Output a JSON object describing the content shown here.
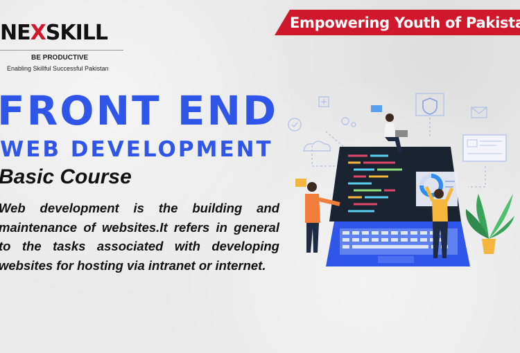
{
  "banner": {
    "text": "Empowering Youth of Pakistan",
    "color": "#d0182c"
  },
  "logo": {
    "word_left": "NE",
    "word_x": "X",
    "word_right": "SKILL",
    "tagline": "BE PRODUCTIVE",
    "subtitle": "Enabling Skillful Successful Pakistan"
  },
  "course": {
    "title_line1": "FRONT END",
    "title_line2": "WEB DEVELOPMENT",
    "subtitle": "Basic Course",
    "description": "Web development is the building and maintenance of websites.It refers in general to the tasks associated with developing websites for hosting via intranet or internet."
  },
  "colors": {
    "accent": "#2f56e8",
    "text": "#111111"
  },
  "illustration": {
    "icons": [
      "shield-icon",
      "mail-icon",
      "search-icon",
      "settings-icon",
      "cloud-icon",
      "chat-icon",
      "plant-icon",
      "laptop-icon"
    ]
  }
}
